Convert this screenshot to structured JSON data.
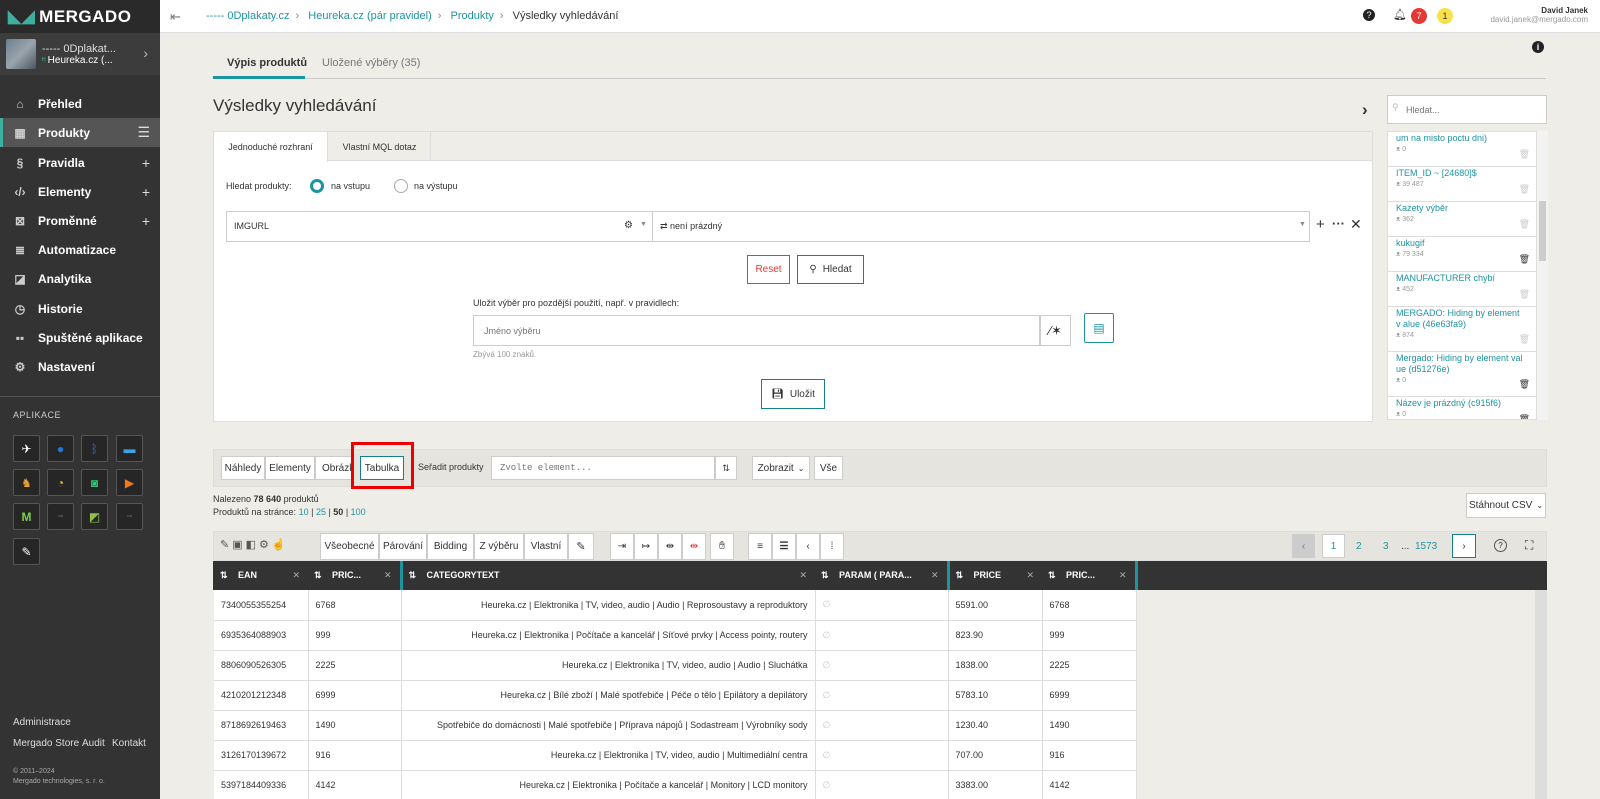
{
  "sidebar": {
    "logo": "MERGADO",
    "project": {
      "title": "----- 0Dplakat...",
      "subtitle": "Heureka.cz (..."
    },
    "nav": [
      {
        "label": "Přehled",
        "icon": "home-icon"
      },
      {
        "label": "Produkty",
        "icon": "boxes-icon"
      },
      {
        "label": "Pravidla",
        "icon": "paragraph-icon"
      },
      {
        "label": "Elementy",
        "icon": "code-icon"
      },
      {
        "label": "Proměnné",
        "icon": "variable-icon"
      },
      {
        "label": "Automatizace",
        "icon": "automation-icon"
      },
      {
        "label": "Analytika",
        "icon": "chart-icon"
      },
      {
        "label": "Historie",
        "icon": "history-icon"
      },
      {
        "label": "Spuštěné aplikace",
        "icon": "apps-icon"
      },
      {
        "label": "Nastavení",
        "icon": "gear-icon"
      }
    ],
    "apps_title": "APLIKACE",
    "footer": {
      "admin": "Administrace",
      "store": "Mergado Store",
      "audit": "Audit",
      "contact": "Kontakt",
      "copyright": "© 2011–2024",
      "company": "Mergado technologies, s. r. o."
    }
  },
  "breadcrumb": [
    "----- 0Dplakaty.cz",
    "Heureka.cz (pár pravidel)",
    "Produkty",
    "Výsledky vyhledávání"
  ],
  "user": {
    "name": "David Janek",
    "email": "david.janek@mergado.com",
    "notif_count": "7",
    "alert_count": "1"
  },
  "tabs": [
    "Výpis produktů",
    "Uložené výběry (35)"
  ],
  "page_title": "Výsledky vyhledávání",
  "search_panel": {
    "tabs": [
      "Jednoduché rozhraní",
      "Vlastní MQL dotaz"
    ],
    "search_label": "Hledat produkty:",
    "radio_input": "na vstupu",
    "radio_output": "na výstupu",
    "element": "IMGURL",
    "condition": "není prázdný",
    "reset": "Reset",
    "search": "Hledat",
    "save_label": "Uložit výběr pro pozdější použití, např. v pravidlech:",
    "name_placeholder": "Jméno výběru",
    "remaining": "Zbývá 100 znaků.",
    "save": "Uložit"
  },
  "saved_selections": {
    "search_placeholder": "Hledat...",
    "items": [
      {
        "name": "um na misto poctu dni)",
        "count": "0"
      },
      {
        "name": "ITEM_ID ~ [24680]$",
        "count": "39 487"
      },
      {
        "name": "Kazety výběr",
        "count": "362"
      },
      {
        "name": "kukugif",
        "count": "79 334"
      },
      {
        "name": "MANUFACTURER chybí",
        "count": "452"
      },
      {
        "name": "MERGADO: Hiding by element v alue (46e63fa9)",
        "count": "874"
      },
      {
        "name": "Mergado: Hiding by element val ue (d51276e)",
        "count": "0"
      },
      {
        "name": "Název je prázdný (c915f6)",
        "count": "0"
      }
    ]
  },
  "view_bar": {
    "views": [
      "Náhledy",
      "Elementy",
      "Obrázky",
      "Tabulka"
    ],
    "sort_label": "Seřadit produkty",
    "sort_placeholder": "Zvolte element...",
    "show": "Zobrazit",
    "all": "Vše"
  },
  "results": {
    "found_prefix": "Nalezeno",
    "found_count": "78 640",
    "found_suffix": "produktů",
    "per_page_label": "Produktů na stránce:",
    "per_page": [
      "10",
      "25",
      "50",
      "100"
    ],
    "download": "Stáhnout CSV"
  },
  "table_toolbar": {
    "groups": [
      "Všeobecné",
      "Párování",
      "Bidding",
      "Z výběru",
      "Vlastní"
    ],
    "pages": [
      "1",
      "2",
      "3",
      "...",
      "1573"
    ]
  },
  "table": {
    "columns": [
      "EAN",
      "PRIC...",
      "CATEGORYTEXT",
      "PARAM ( PARA...",
      "PRICE",
      "PRIC..."
    ],
    "rows": [
      [
        "7340055355254",
        "6768",
        "Heureka.cz | Elektronika | TV, video, audio | Audio | Reprosoustavy a reproduktory",
        "",
        "5591.00",
        "6768"
      ],
      [
        "6935364088903",
        "999",
        "Heureka.cz | Elektronika | Počítače a kancelář | Síťové prvky | Access pointy, routery",
        "",
        "823.90",
        "999"
      ],
      [
        "8806090526305",
        "2225",
        "Heureka.cz | Elektronika | TV, video, audio | Audio | Sluchátka",
        "",
        "1838.00",
        "2225"
      ],
      [
        "4210201212348",
        "6999",
        "Heureka.cz | Bílé zboží | Malé spotřebiče | Péče o tělo | Epilátory a depilátory",
        "",
        "5783.10",
        "6999"
      ],
      [
        "8718692619463",
        "1490",
        "Spotřebiče do domácnosti | Malé spotřebiče | Příprava nápojů | Sodastream | Výrobníky sody",
        "",
        "1230.40",
        "1490"
      ],
      [
        "3126170139672",
        "916",
        "Heureka.cz | Elektronika | TV, video, audio | Multimediální centra",
        "",
        "707.00",
        "916"
      ],
      [
        "5397184409336",
        "4142",
        "Heureka.cz | Elektronika | Počítače a kancelář | Monitory | LCD monitory",
        "",
        "3383.00",
        "4142"
      ]
    ]
  }
}
